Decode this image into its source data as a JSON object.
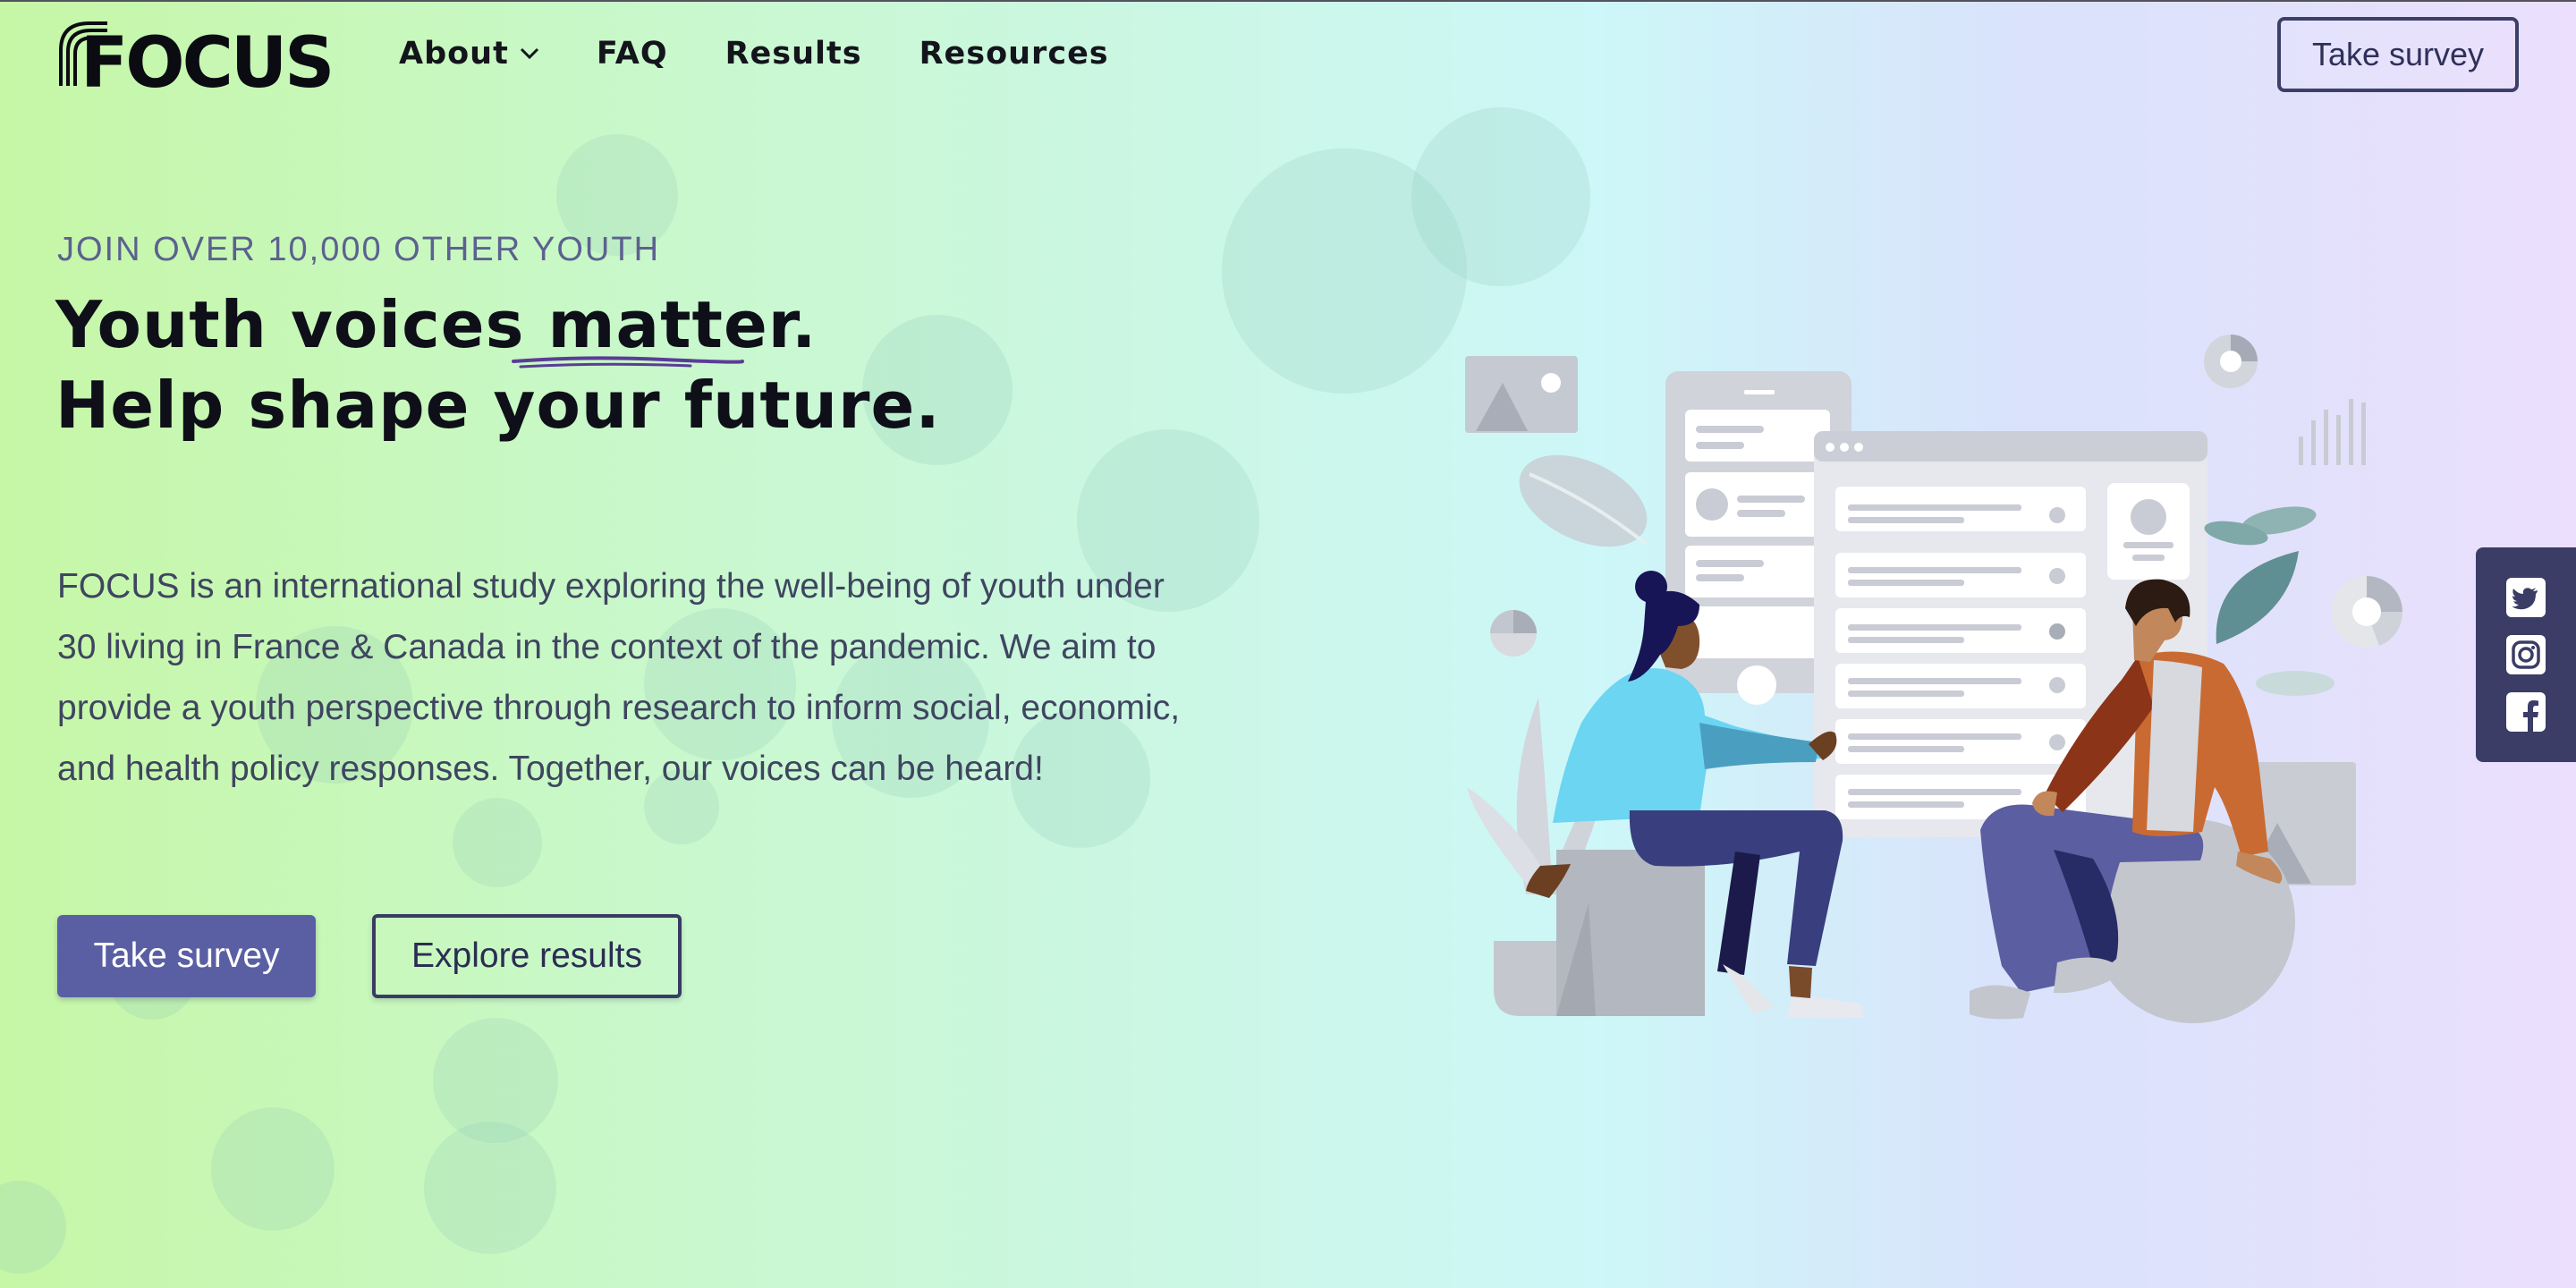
{
  "header": {
    "logo_text": "FOCUS",
    "nav": [
      {
        "label": "About",
        "has_dropdown": true
      },
      {
        "label": "FAQ"
      },
      {
        "label": "Results"
      },
      {
        "label": "Resources"
      }
    ],
    "cta_label": "Take survey"
  },
  "hero": {
    "eyebrow": "JOIN OVER 10,000 OTHER YOUTH",
    "headline_line1_a": "Youth voices ",
    "headline_line1_b": "matter",
    "headline_line1_c": ".",
    "headline_line2": "Help shape your future.",
    "description_lines": [
      "FOCUS is an international study exploring the well-being of youth under",
      "30 living in France & Canada in the context of the pandemic. We aim to",
      "provide a youth perspective through research to inform social, economic,",
      "and health policy responses. Together, our voices can be heard!"
    ],
    "primary_button": "Take survey",
    "secondary_button": "Explore results"
  },
  "social": [
    "twitter-icon",
    "instagram-icon",
    "facebook-icon"
  ],
  "colors": {
    "accent": "#5a5fa4",
    "dark_navy": "#3b3d66",
    "eyebrow": "#5c6190",
    "underline": "#5b3c98"
  }
}
